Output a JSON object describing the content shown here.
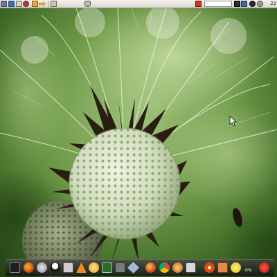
{
  "top_panel": {
    "search_placeholder": "",
    "clock": "22",
    "launchers": [
      "files-icon",
      "monitor-icon",
      "mail-icon",
      "camera-icon",
      "home-folder-icon",
      "arrow-icon",
      "divider",
      "notes-icon"
    ],
    "tray": [
      "applet-icon",
      "red-indicator-icon",
      "terminal-tray-icon",
      "network-icon",
      "volume-icon",
      "user-icon",
      "power-tray-icon"
    ]
  },
  "desktop": {
    "wallpaper": "dandelion-macro-photo"
  },
  "dock": {
    "items": [
      {
        "name": "terminal-icon"
      },
      {
        "name": "firefox-icon"
      },
      {
        "name": "settings-icon"
      },
      {
        "name": "penguin-icon"
      },
      {
        "name": "storage-icon"
      },
      {
        "name": "vlc-icon"
      },
      {
        "name": "media-icon"
      },
      {
        "name": "monitor-app-icon"
      },
      {
        "name": "tools-icon"
      },
      {
        "name": "diamond-icon"
      },
      {
        "name": "browser-icon"
      },
      {
        "name": "chrome-icon"
      },
      {
        "name": "flame-icon"
      },
      {
        "name": "photos-icon"
      },
      {
        "name": "ubuntu-icon"
      },
      {
        "name": "folder-icon"
      },
      {
        "name": "smiley-icon"
      },
      {
        "name": "power-icon"
      }
    ],
    "battery_label": "0%"
  },
  "colors": {
    "panel": "#e4e0d8",
    "dock": "#2a2a2a",
    "seed_head": "#dfe9cf",
    "bracts": "#2a1d12",
    "background": "#5a8a3a"
  }
}
